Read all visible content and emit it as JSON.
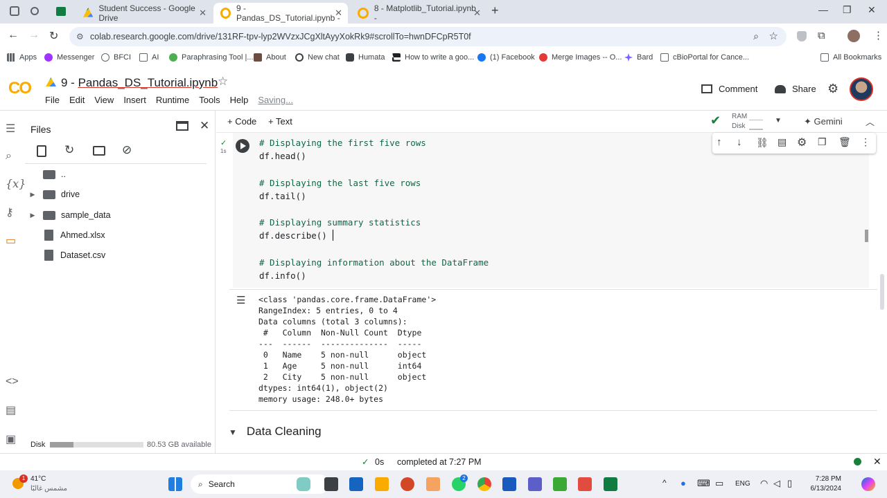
{
  "browser": {
    "tabs": [
      {
        "title": "Student Success - Google Drive"
      },
      {
        "title": "9 - Pandas_DS_Tutorial.ipynb - "
      },
      {
        "title": "8 - Matplotlib_Tutorial.ipynb - "
      }
    ],
    "url": "colab.research.google.com/drive/131RF-tpv-lyp2WVzxJCgXltAyyXokRk9#scrollTo=hwnDFCpR5T0f",
    "bookmarks": [
      "Apps",
      "Messenger",
      "BFCI",
      "AI",
      "Paraphrasing Tool |...",
      "About",
      "New chat",
      "Humata",
      "How to write a goo...",
      "(1) Facebook",
      "Merge Images -- O...",
      "Bard",
      "cBioPortal for Cance...",
      "All Bookmarks"
    ]
  },
  "colab": {
    "logo": "CO",
    "notebook_prefix": "9 - ",
    "notebook_name": "Pandas_DS_Tutorial.ipynb",
    "menu": [
      "File",
      "Edit",
      "View",
      "Insert",
      "Runtime",
      "Tools",
      "Help"
    ],
    "saving": "Saving...",
    "comment": "Comment",
    "share": "Share",
    "add_code": "+ Code",
    "add_text": "+ Text",
    "ram": "RAM",
    "disk": "Disk",
    "gemini": "Gemini"
  },
  "files_panel": {
    "title": "Files",
    "items": [
      "..",
      "drive",
      "sample_data",
      "Ahmed.xlsx",
      "Dataset.csv"
    ],
    "disk_label": "Disk",
    "disk_available": "80.53 GB available",
    "disk_used_fraction": 0.25
  },
  "cell": {
    "exec_time": "1s",
    "lines": [
      "# Displaying the first five rows",
      "df.head()",
      "",
      "# Displaying the last five rows",
      "df.tail()",
      "",
      "# Displaying summary statistics",
      "df.describe()",
      "",
      "# Displaying information about the DataFrame",
      "df.info()"
    ],
    "output": [
      "<class 'pandas.core.frame.DataFrame'>",
      "RangeIndex: 5 entries, 0 to 4",
      "Data columns (total 3 columns):",
      " #   Column  Non-Null Count  Dtype ",
      "---  ------  --------------  ----- ",
      " 0   Name    5 non-null      object",
      " 1   Age     5 non-null      int64 ",
      " 2   City    5 non-null      object",
      "dtypes: int64(1), object(2)",
      "memory usage: 248.0+ bytes"
    ]
  },
  "section_title": "Data Cleaning",
  "status": {
    "time": "0s",
    "completed": "completed at 7:27 PM"
  },
  "taskbar": {
    "weather_temp": "41°C",
    "weather_desc": "مشمس غالبًا",
    "search": "Search",
    "lang": "ENG",
    "clock_time": "7:28 PM",
    "clock_date": "6/13/2024",
    "notif": "1",
    "badge": "2"
  }
}
